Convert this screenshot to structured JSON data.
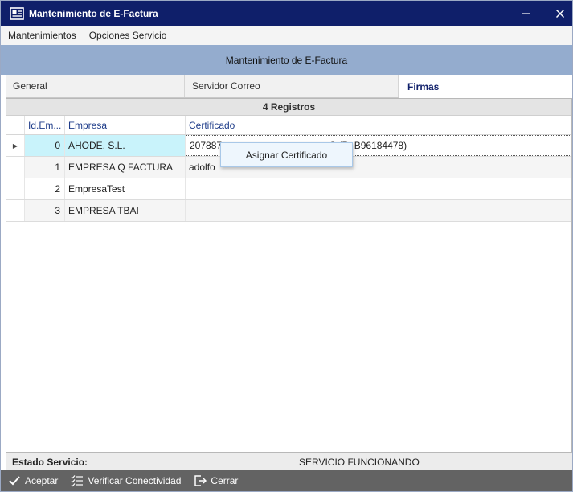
{
  "window": {
    "title": "Mantenimiento de E-Factura"
  },
  "menu": {
    "items": [
      "Mantenimientos",
      "Opciones Servicio"
    ]
  },
  "header": {
    "title": "Mantenimiento de E-Factura"
  },
  "tabs": [
    {
      "label": "General",
      "active": false
    },
    {
      "label": "Servidor Correo",
      "active": false
    },
    {
      "label": "Firmas",
      "active": true
    }
  ],
  "grid": {
    "caption": "4 Registros",
    "columns": [
      "Id.Em...",
      "Empresa",
      "Certificado"
    ],
    "rows": [
      {
        "id": "0",
        "empresa": "AHODE, S.L.",
        "certificado": "207887",
        "certificado_tail": "S (R: B96184478)"
      },
      {
        "id": "1",
        "empresa": "EMPRESA Q FACTURA",
        "certificado": "adolfo",
        "certificado_tail": ""
      },
      {
        "id": "2",
        "empresa": "EmpresaTest",
        "certificado": "",
        "certificado_tail": ""
      },
      {
        "id": "3",
        "empresa": "EMPRESA TBAI",
        "certificado": "",
        "certificado_tail": ""
      }
    ]
  },
  "context_menu": {
    "item": "Asignar Certificado"
  },
  "status": {
    "label": "Estado Servicio:",
    "value": "SERVICIO FUNCIONANDO"
  },
  "toolbar": {
    "accept": "Aceptar",
    "verify": "Verificar Conectividad",
    "close": "Cerrar"
  },
  "colors": {
    "titlebar": "#0f1f6a",
    "header_band": "#94acce",
    "selected_row": "#c9f3fb",
    "toolbar": "#636363"
  }
}
